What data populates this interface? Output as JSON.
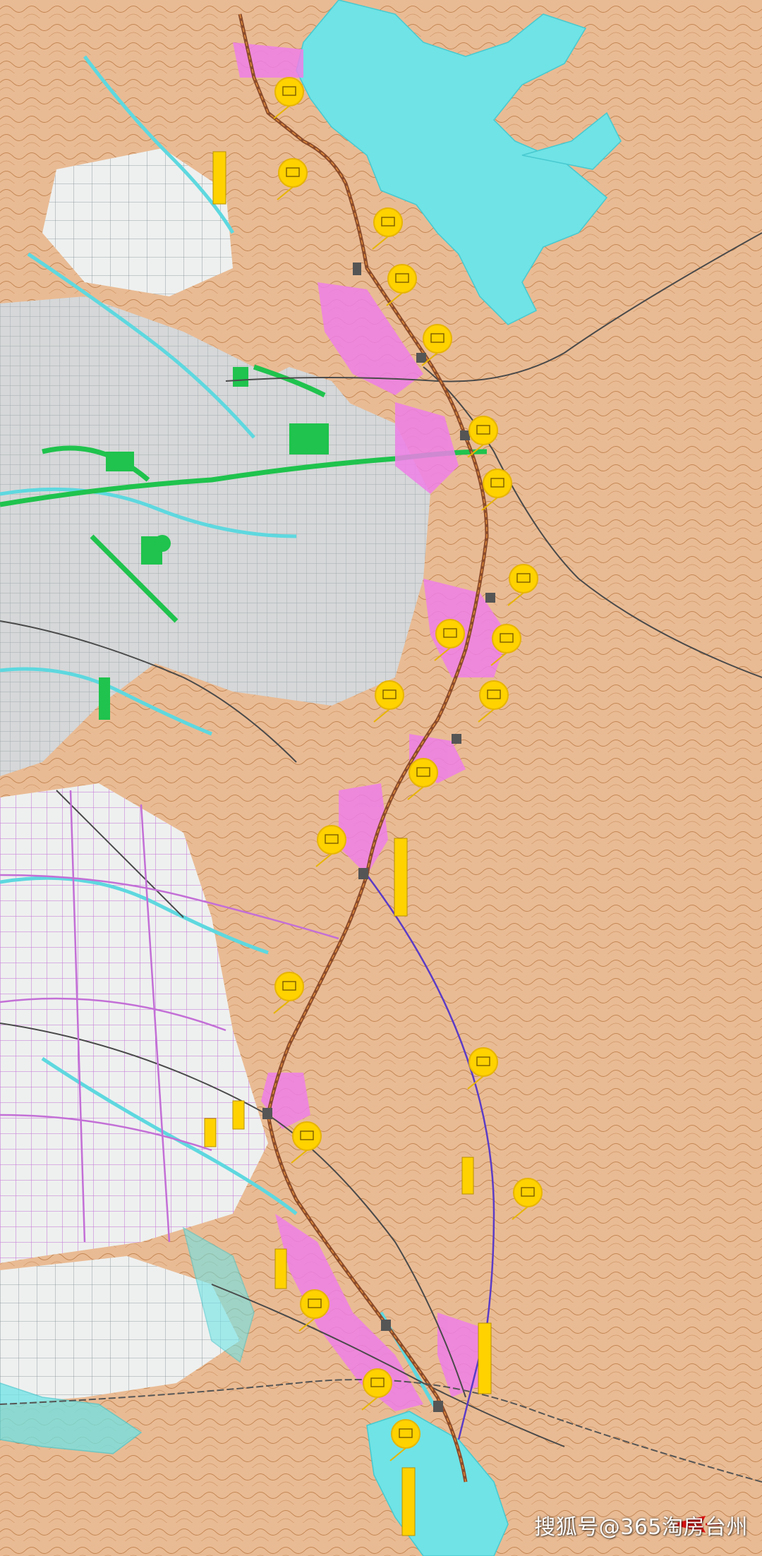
{
  "map": {
    "colors": {
      "land": "#efe2cf",
      "hill": "#e8b48a",
      "contour": "#b8753f",
      "water": "#6fe3e6",
      "urban": "#d5d7d8",
      "park": "#1fc34d",
      "development": "#ee7fe8",
      "route_main": "#8a4b2b",
      "route_alt": "#5b3cc6",
      "marker": "#ffd200",
      "marker_ring": "#e7b500"
    },
    "markers": [
      {
        "icon": "station-marker-icon"
      },
      {
        "icon": "station-marker-icon"
      },
      {
        "icon": "station-marker-icon"
      },
      {
        "icon": "station-marker-icon"
      },
      {
        "icon": "station-marker-icon"
      },
      {
        "icon": "station-marker-icon"
      },
      {
        "icon": "station-marker-icon"
      },
      {
        "icon": "station-marker-icon"
      },
      {
        "icon": "station-marker-icon"
      },
      {
        "icon": "station-marker-icon"
      },
      {
        "icon": "station-marker-icon"
      },
      {
        "icon": "station-marker-icon"
      },
      {
        "icon": "station-marker-icon"
      },
      {
        "icon": "station-marker-icon"
      },
      {
        "icon": "station-marker-icon"
      },
      {
        "icon": "station-marker-icon"
      },
      {
        "icon": "station-marker-icon"
      },
      {
        "icon": "station-marker-icon"
      },
      {
        "icon": "station-marker-icon"
      },
      {
        "icon": "station-marker-icon"
      },
      {
        "icon": "station-marker-icon"
      }
    ],
    "north_arrow": {
      "icon": "north-arrow-icon",
      "color": "#e01010"
    },
    "watermark": "搜狐号@365淘房台州"
  }
}
